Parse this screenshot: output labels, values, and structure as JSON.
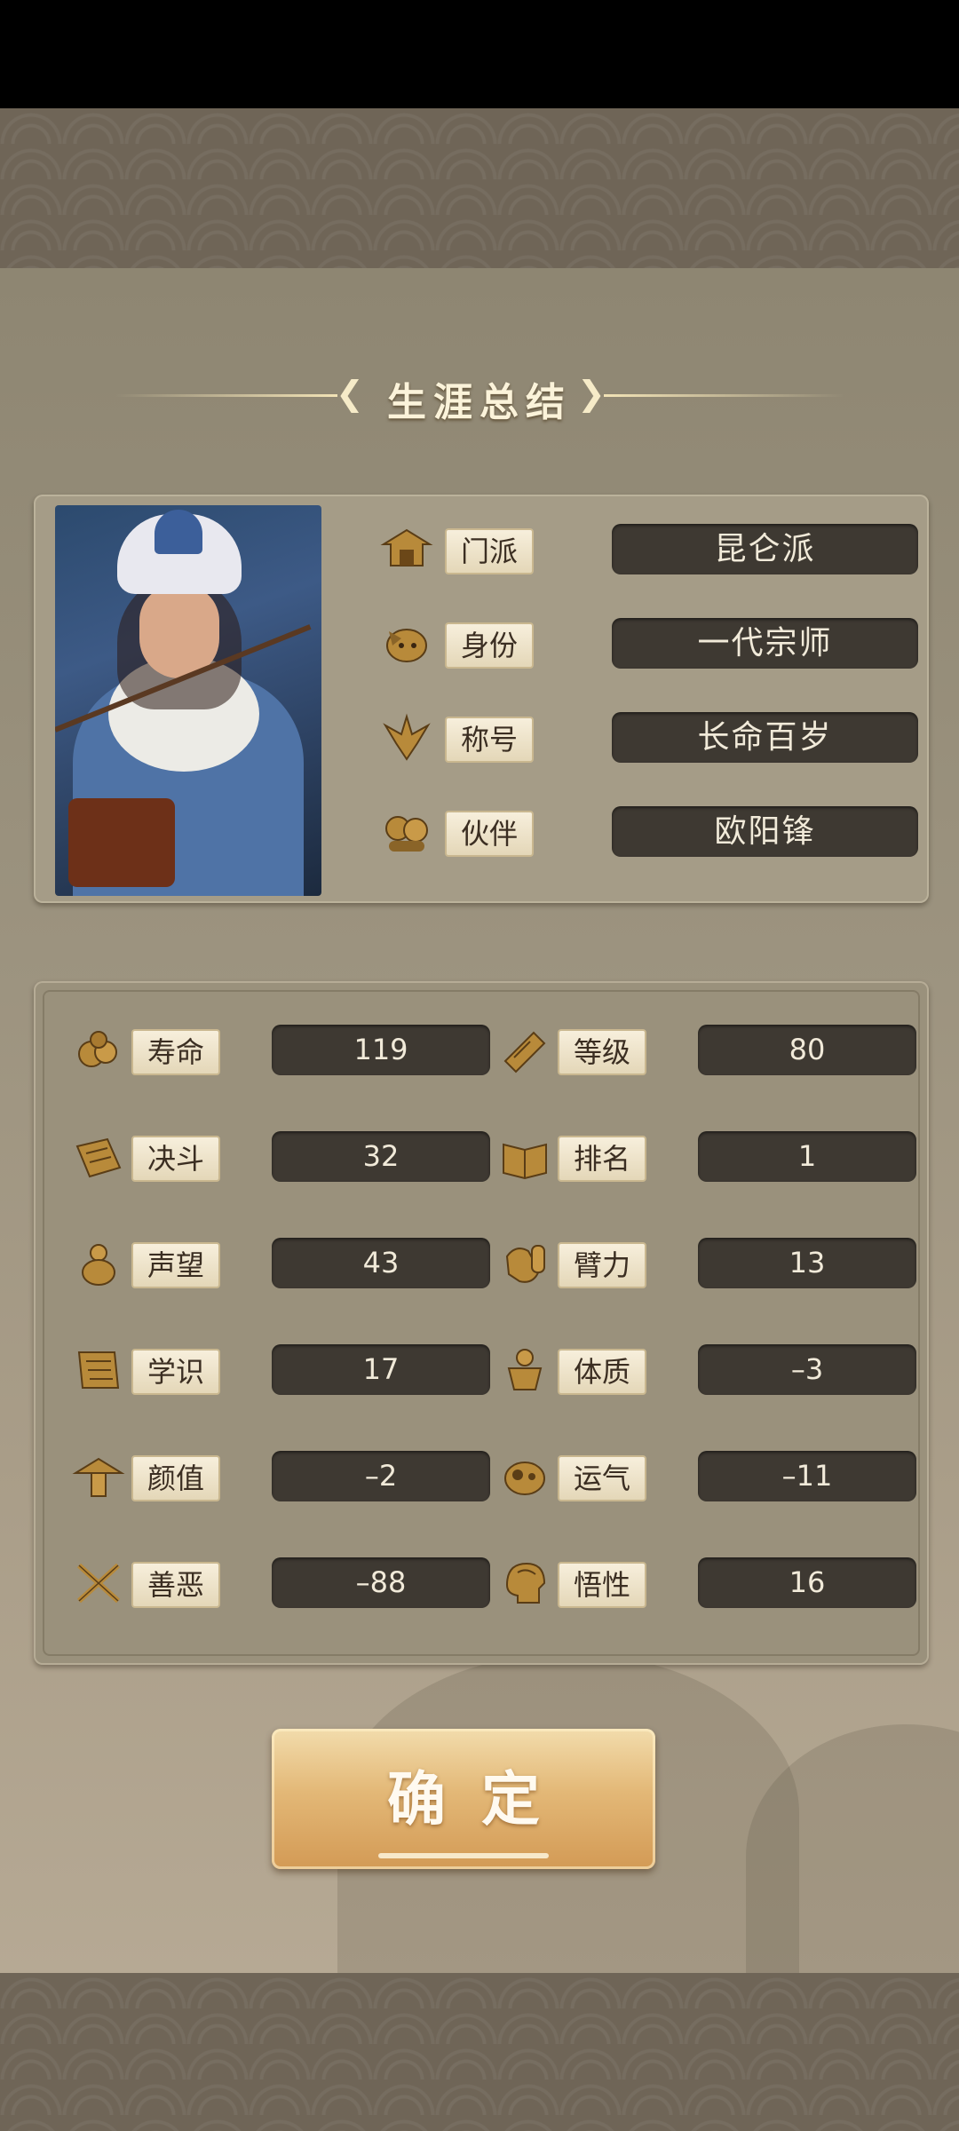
{
  "title": "生涯总结",
  "profile": [
    {
      "label": "门派",
      "value": "昆仑派",
      "icon": "sect-pavilion-icon"
    },
    {
      "label": "身份",
      "value": "一代宗师",
      "icon": "identity-mask-icon"
    },
    {
      "label": "称号",
      "value": "长命百岁",
      "icon": "title-crest-icon"
    },
    {
      "label": "伙伴",
      "value": "欧阳锋",
      "icon": "companions-icon"
    }
  ],
  "stats": [
    {
      "label": "寿命",
      "value": "119",
      "icon": "lifespan-peach-icon"
    },
    {
      "label": "等级",
      "value": "80",
      "icon": "level-scroll-icon"
    },
    {
      "label": "决斗",
      "value": "32",
      "icon": "duel-scroll-icon"
    },
    {
      "label": "排名",
      "value": "1",
      "icon": "ranking-book-icon"
    },
    {
      "label": "声望",
      "value": "43",
      "icon": "reputation-gourd-icon"
    },
    {
      "label": "臂力",
      "value": "13",
      "icon": "strength-arm-icon"
    },
    {
      "label": "学识",
      "value": "17",
      "icon": "knowledge-scroll-icon"
    },
    {
      "label": "体质",
      "value": "–3",
      "icon": "constitution-body-icon"
    },
    {
      "label": "颜值",
      "value": "–2",
      "icon": "appearance-hat-icon"
    },
    {
      "label": "运气",
      "value": "–11",
      "icon": "luck-pouch-icon"
    },
    {
      "label": "善恶",
      "value": "–88",
      "icon": "morality-swords-icon"
    },
    {
      "label": "悟性",
      "value": "16",
      "icon": "comprehension-head-icon"
    }
  ],
  "confirm_label": "确定",
  "colors": {
    "tag_bg": "#f3ead4",
    "value_bg": "#3e3932",
    "icon_gold": "#b88a3a",
    "button_gold": "#e3b877"
  }
}
